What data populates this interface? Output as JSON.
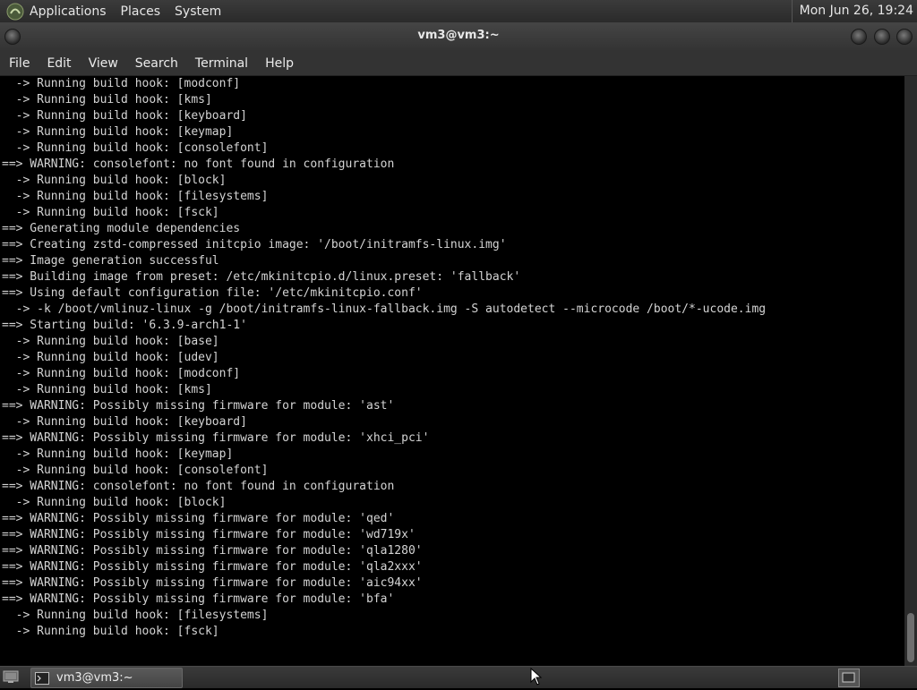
{
  "top_panel": {
    "menus": [
      "Applications",
      "Places",
      "System"
    ],
    "clock": "Mon Jun 26, 19:24"
  },
  "window": {
    "title": "vm3@vm3:~"
  },
  "menubar": {
    "items": [
      "File",
      "Edit",
      "View",
      "Search",
      "Terminal",
      "Help"
    ]
  },
  "terminal": {
    "output": "  -> Running build hook: [modconf]\n  -> Running build hook: [kms]\n  -> Running build hook: [keyboard]\n  -> Running build hook: [keymap]\n  -> Running build hook: [consolefont]\n==> WARNING: consolefont: no font found in configuration\n  -> Running build hook: [block]\n  -> Running build hook: [filesystems]\n  -> Running build hook: [fsck]\n==> Generating module dependencies\n==> Creating zstd-compressed initcpio image: '/boot/initramfs-linux.img'\n==> Image generation successful\n==> Building image from preset: /etc/mkinitcpio.d/linux.preset: 'fallback'\n==> Using default configuration file: '/etc/mkinitcpio.conf'\n  -> -k /boot/vmlinuz-linux -g /boot/initramfs-linux-fallback.img -S autodetect --microcode /boot/*-ucode.img\n==> Starting build: '6.3.9-arch1-1'\n  -> Running build hook: [base]\n  -> Running build hook: [udev]\n  -> Running build hook: [modconf]\n  -> Running build hook: [kms]\n==> WARNING: Possibly missing firmware for module: 'ast'\n  -> Running build hook: [keyboard]\n==> WARNING: Possibly missing firmware for module: 'xhci_pci'\n  -> Running build hook: [keymap]\n  -> Running build hook: [consolefont]\n==> WARNING: consolefont: no font found in configuration\n  -> Running build hook: [block]\n==> WARNING: Possibly missing firmware for module: 'qed'\n==> WARNING: Possibly missing firmware for module: 'wd719x'\n==> WARNING: Possibly missing firmware for module: 'qla1280'\n==> WARNING: Possibly missing firmware for module: 'qla2xxx'\n==> WARNING: Possibly missing firmware for module: 'aic94xx'\n==> WARNING: Possibly missing firmware for module: 'bfa'\n  -> Running build hook: [filesystems]\n  -> Running build hook: [fsck]"
  },
  "taskbar": {
    "task_label": "vm3@vm3:~"
  },
  "icons": {
    "logo": "mate-logo-icon",
    "show_desktop": "show-desktop-icon",
    "task": "terminal-icon",
    "workspace": "workspace-switcher-icon"
  },
  "colors": {
    "panel": "#2f2f2f",
    "terminal_bg": "#000000",
    "terminal_fg": "#d4d4d4"
  }
}
